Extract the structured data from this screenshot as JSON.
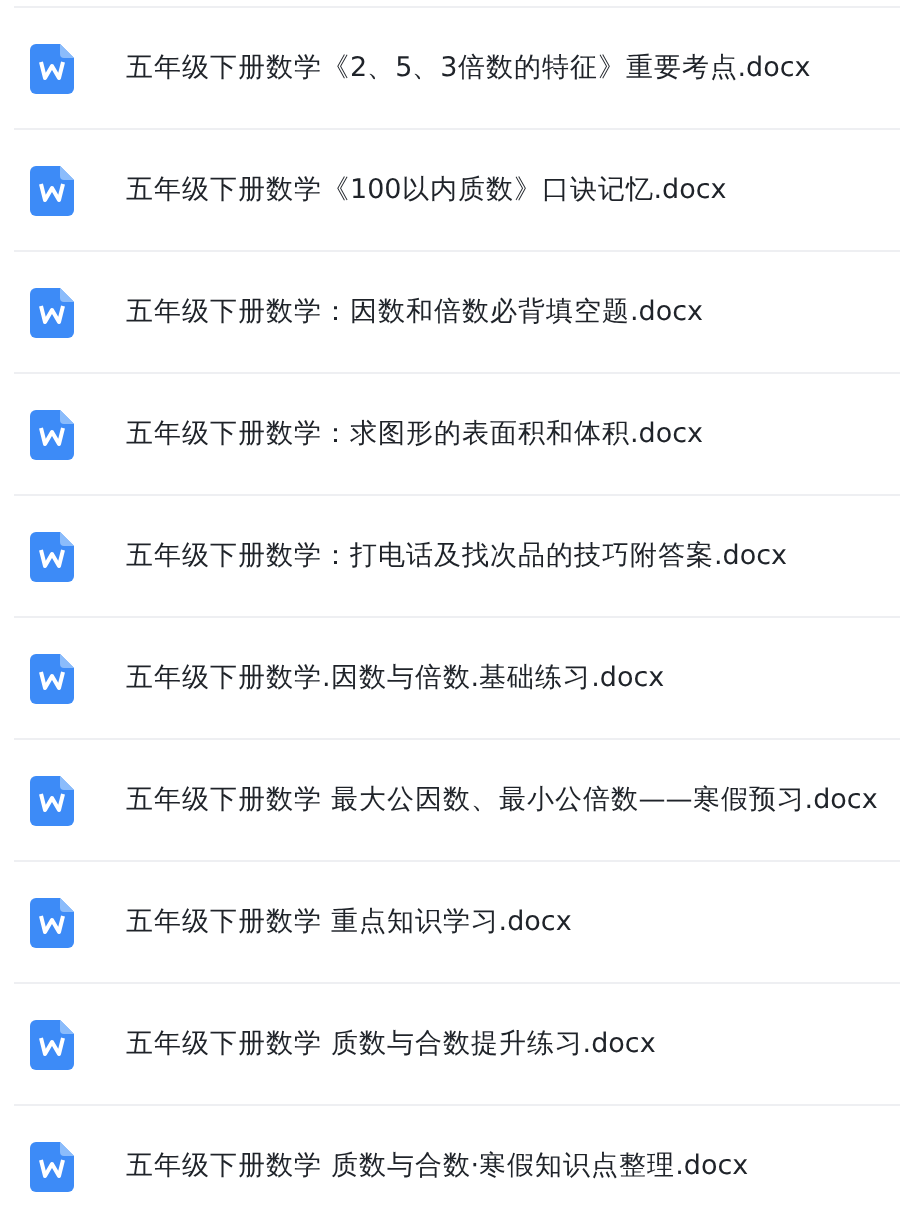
{
  "files": [
    {
      "name": "五年级下册数学《2、5、3倍数的特征》重要考点.docx"
    },
    {
      "name": "五年级下册数学《100以内质数》口诀记忆.docx"
    },
    {
      "name": "五年级下册数学：因数和倍数必背填空题.docx"
    },
    {
      "name": "五年级下册数学：求图形的表面积和体积.docx"
    },
    {
      "name": "五年级下册数学：打电话及找次品的技巧附答案.docx"
    },
    {
      "name": "五年级下册数学.因数与倍数.基础练习.docx"
    },
    {
      "name": "五年级下册数学 最大公因数、最小公倍数——寒假预习.docx"
    },
    {
      "name": "五年级下册数学 重点知识学习.docx"
    },
    {
      "name": "五年级下册数学 质数与合数提升练习.docx"
    },
    {
      "name": "五年级下册数学 质数与合数·寒假知识点整理.docx"
    }
  ]
}
